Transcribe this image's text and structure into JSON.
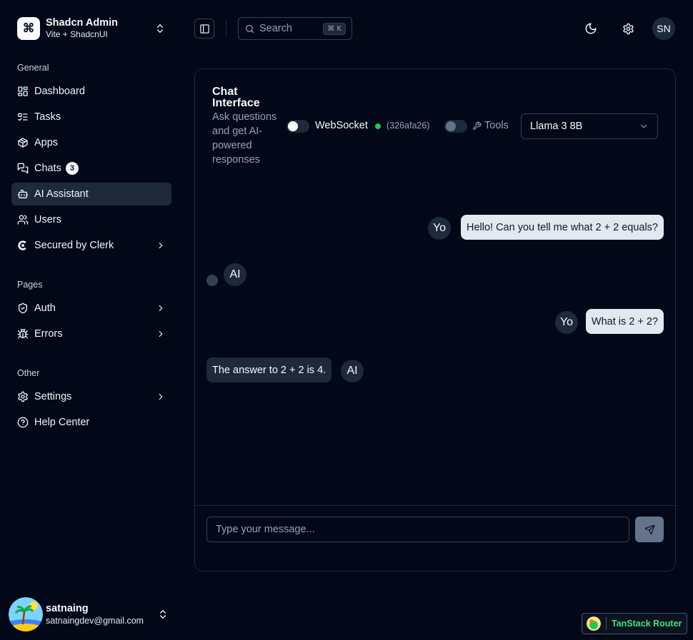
{
  "team": {
    "name": "Shadcn Admin",
    "plan": "Vite + ShadcnUI",
    "logo_glyph": "⌘"
  },
  "sidebar": {
    "groups": [
      {
        "label": "General"
      },
      {
        "label": "Pages"
      },
      {
        "label": "Other"
      }
    ],
    "items": [
      {
        "label": "Dashboard",
        "icon": "layout-dashboard-icon"
      },
      {
        "label": "Tasks",
        "icon": "list-todo-icon"
      },
      {
        "label": "Apps",
        "icon": "package-icon"
      },
      {
        "label": "Chats",
        "icon": "messages-icon",
        "badge": "3"
      },
      {
        "label": "AI Assistant",
        "icon": "bot-icon",
        "active": true
      },
      {
        "label": "Users",
        "icon": "users-icon"
      },
      {
        "label": "Secured by Clerk",
        "icon": "clerk-icon"
      },
      {
        "label": "Auth",
        "icon": "shield-check-icon"
      },
      {
        "label": "Errors",
        "icon": "bug-icon"
      },
      {
        "label": "Settings",
        "icon": "settings-icon"
      },
      {
        "label": "Help Center",
        "icon": "help-circle-icon"
      }
    ]
  },
  "user": {
    "name": "satnaing",
    "email": "satnaingdev@gmail.com"
  },
  "header": {
    "search_placeholder": "Search",
    "search_shortcut": "⌘ K",
    "avatar_initials": "SN"
  },
  "chat": {
    "title": "Chat Interface",
    "description": "Ask questions and get AI-powered responses",
    "websocket_label": "WebSocket",
    "websocket_enabled": false,
    "connection_id": "(326afa26)",
    "status_color": "#22c55e",
    "tools_label": "Tools",
    "tools_enabled": false,
    "model": "Llama 3 8B",
    "messages": [
      {
        "role": "user",
        "avatar": "Yo",
        "text": "Hello! Can you tell me what 2 + 2 equals?"
      },
      {
        "role": "assistant",
        "avatar": "AI",
        "text": ""
      },
      {
        "role": "user",
        "avatar": "Yo",
        "text": "What is 2 + 2?"
      },
      {
        "role": "assistant",
        "avatar": "AI",
        "text": "The answer to 2 + 2 is 4."
      }
    ],
    "input_placeholder": "Type your message..."
  },
  "devtools": {
    "label": "TanStack Router"
  },
  "colors": {
    "background": "#020817",
    "accent": "#1e293b",
    "success": "#22c55e",
    "devtools_text": "#4ade80"
  }
}
